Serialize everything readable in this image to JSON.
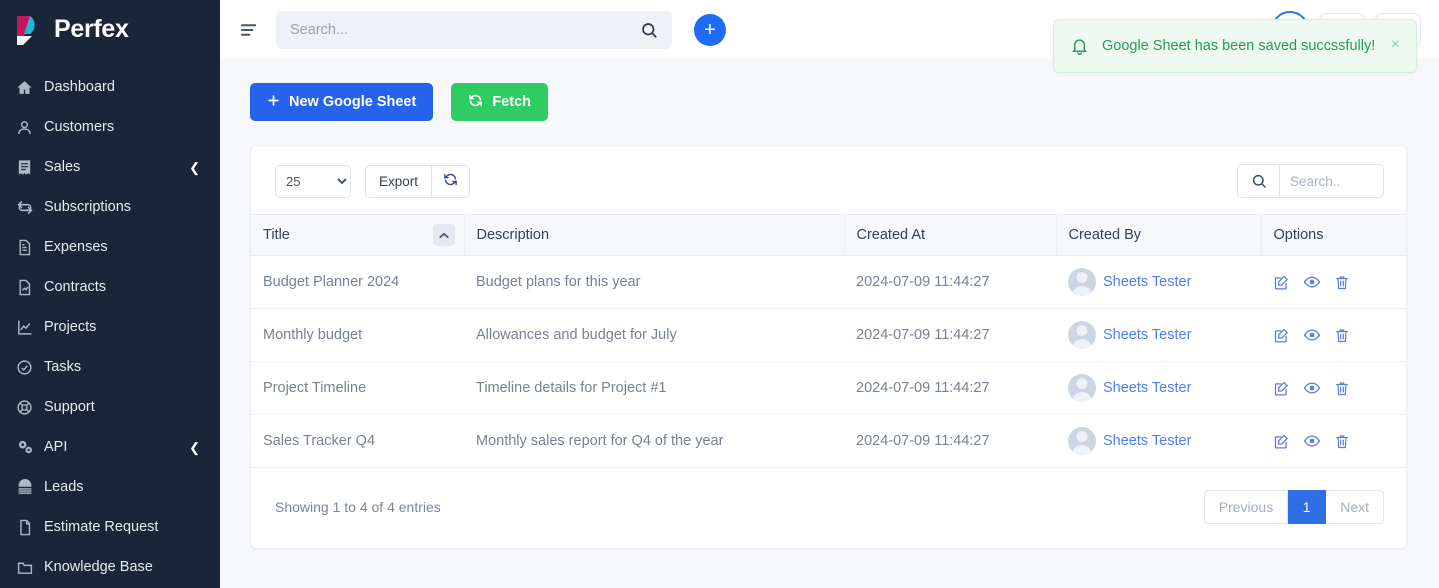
{
  "brand": {
    "name": "Perfex"
  },
  "sidebar": {
    "items": [
      {
        "label": "Dashboard",
        "icon": "home-icon",
        "caret": false
      },
      {
        "label": "Customers",
        "icon": "user-icon",
        "caret": false
      },
      {
        "label": "Sales",
        "icon": "receipt-icon",
        "caret": true
      },
      {
        "label": "Subscriptions",
        "icon": "refresh-cycle-icon",
        "caret": false
      },
      {
        "label": "Expenses",
        "icon": "document-icon",
        "caret": false
      },
      {
        "label": "Contracts",
        "icon": "contract-icon",
        "caret": false
      },
      {
        "label": "Projects",
        "icon": "chart-icon",
        "caret": false
      },
      {
        "label": "Tasks",
        "icon": "check-circle-icon",
        "caret": false
      },
      {
        "label": "Support",
        "icon": "lifebuoy-icon",
        "caret": false
      },
      {
        "label": "API",
        "icon": "gears-icon",
        "caret": true
      },
      {
        "label": "Leads",
        "icon": "leads-icon",
        "caret": false
      },
      {
        "label": "Estimate Request",
        "icon": "file-icon",
        "caret": false
      },
      {
        "label": "Knowledge Base",
        "icon": "folder-icon",
        "caret": false
      }
    ]
  },
  "topbar": {
    "menu_toggle": "list-menu-icon",
    "search": {
      "placeholder": "Search...",
      "value": ""
    },
    "search_icon": "search-icon",
    "add_label": "+"
  },
  "toast": {
    "icon": "bell-icon",
    "message": "Google Sheet has been saved succssfully!",
    "close": "×",
    "color": "#2a9b52",
    "background": "#eefaf1"
  },
  "actions": {
    "new_sheet_label": "New Google Sheet",
    "new_sheet_icon": "plus-icon",
    "new_sheet_color": "#2563eb",
    "fetch_label": "Fetch",
    "fetch_icon": "refresh-icon",
    "fetch_color": "#2ecc63"
  },
  "table": {
    "page_length": "25",
    "page_length_options": [
      "25"
    ],
    "export_label": "Export",
    "refresh_icon": "refresh-icon",
    "search": {
      "placeholder": "Search..",
      "value": ""
    },
    "search_icon": "search-icon",
    "sort_column": "Title",
    "sort_direction": "asc",
    "sort_icon": "chevron-up-icon",
    "columns": [
      "Title",
      "Description",
      "Created At",
      "Created By",
      "Options"
    ],
    "rows": [
      {
        "title": "Budget Planner 2024",
        "description": "Budget plans for this year",
        "created_at": "2024-07-09 11:44:27",
        "created_by": "Sheets Tester"
      },
      {
        "title": "Monthly budget",
        "description": "Allowances and budget for July",
        "created_at": "2024-07-09 11:44:27",
        "created_by": "Sheets Tester"
      },
      {
        "title": "Project Timeline",
        "description": "Timeline details for Project #1",
        "created_at": "2024-07-09 11:44:27",
        "created_by": "Sheets Tester"
      },
      {
        "title": "Sales Tracker Q4",
        "description": "Monthly sales report for Q4 of the year",
        "created_at": "2024-07-09 11:44:27",
        "created_by": "Sheets Tester"
      }
    ],
    "row_actions": [
      "edit-icon",
      "view-icon",
      "delete-icon"
    ],
    "entries_info": "Showing 1 to 4 of 4 entries",
    "pagination": {
      "previous": "Previous",
      "pages": [
        "1"
      ],
      "active_page": "1",
      "next": "Next"
    }
  }
}
